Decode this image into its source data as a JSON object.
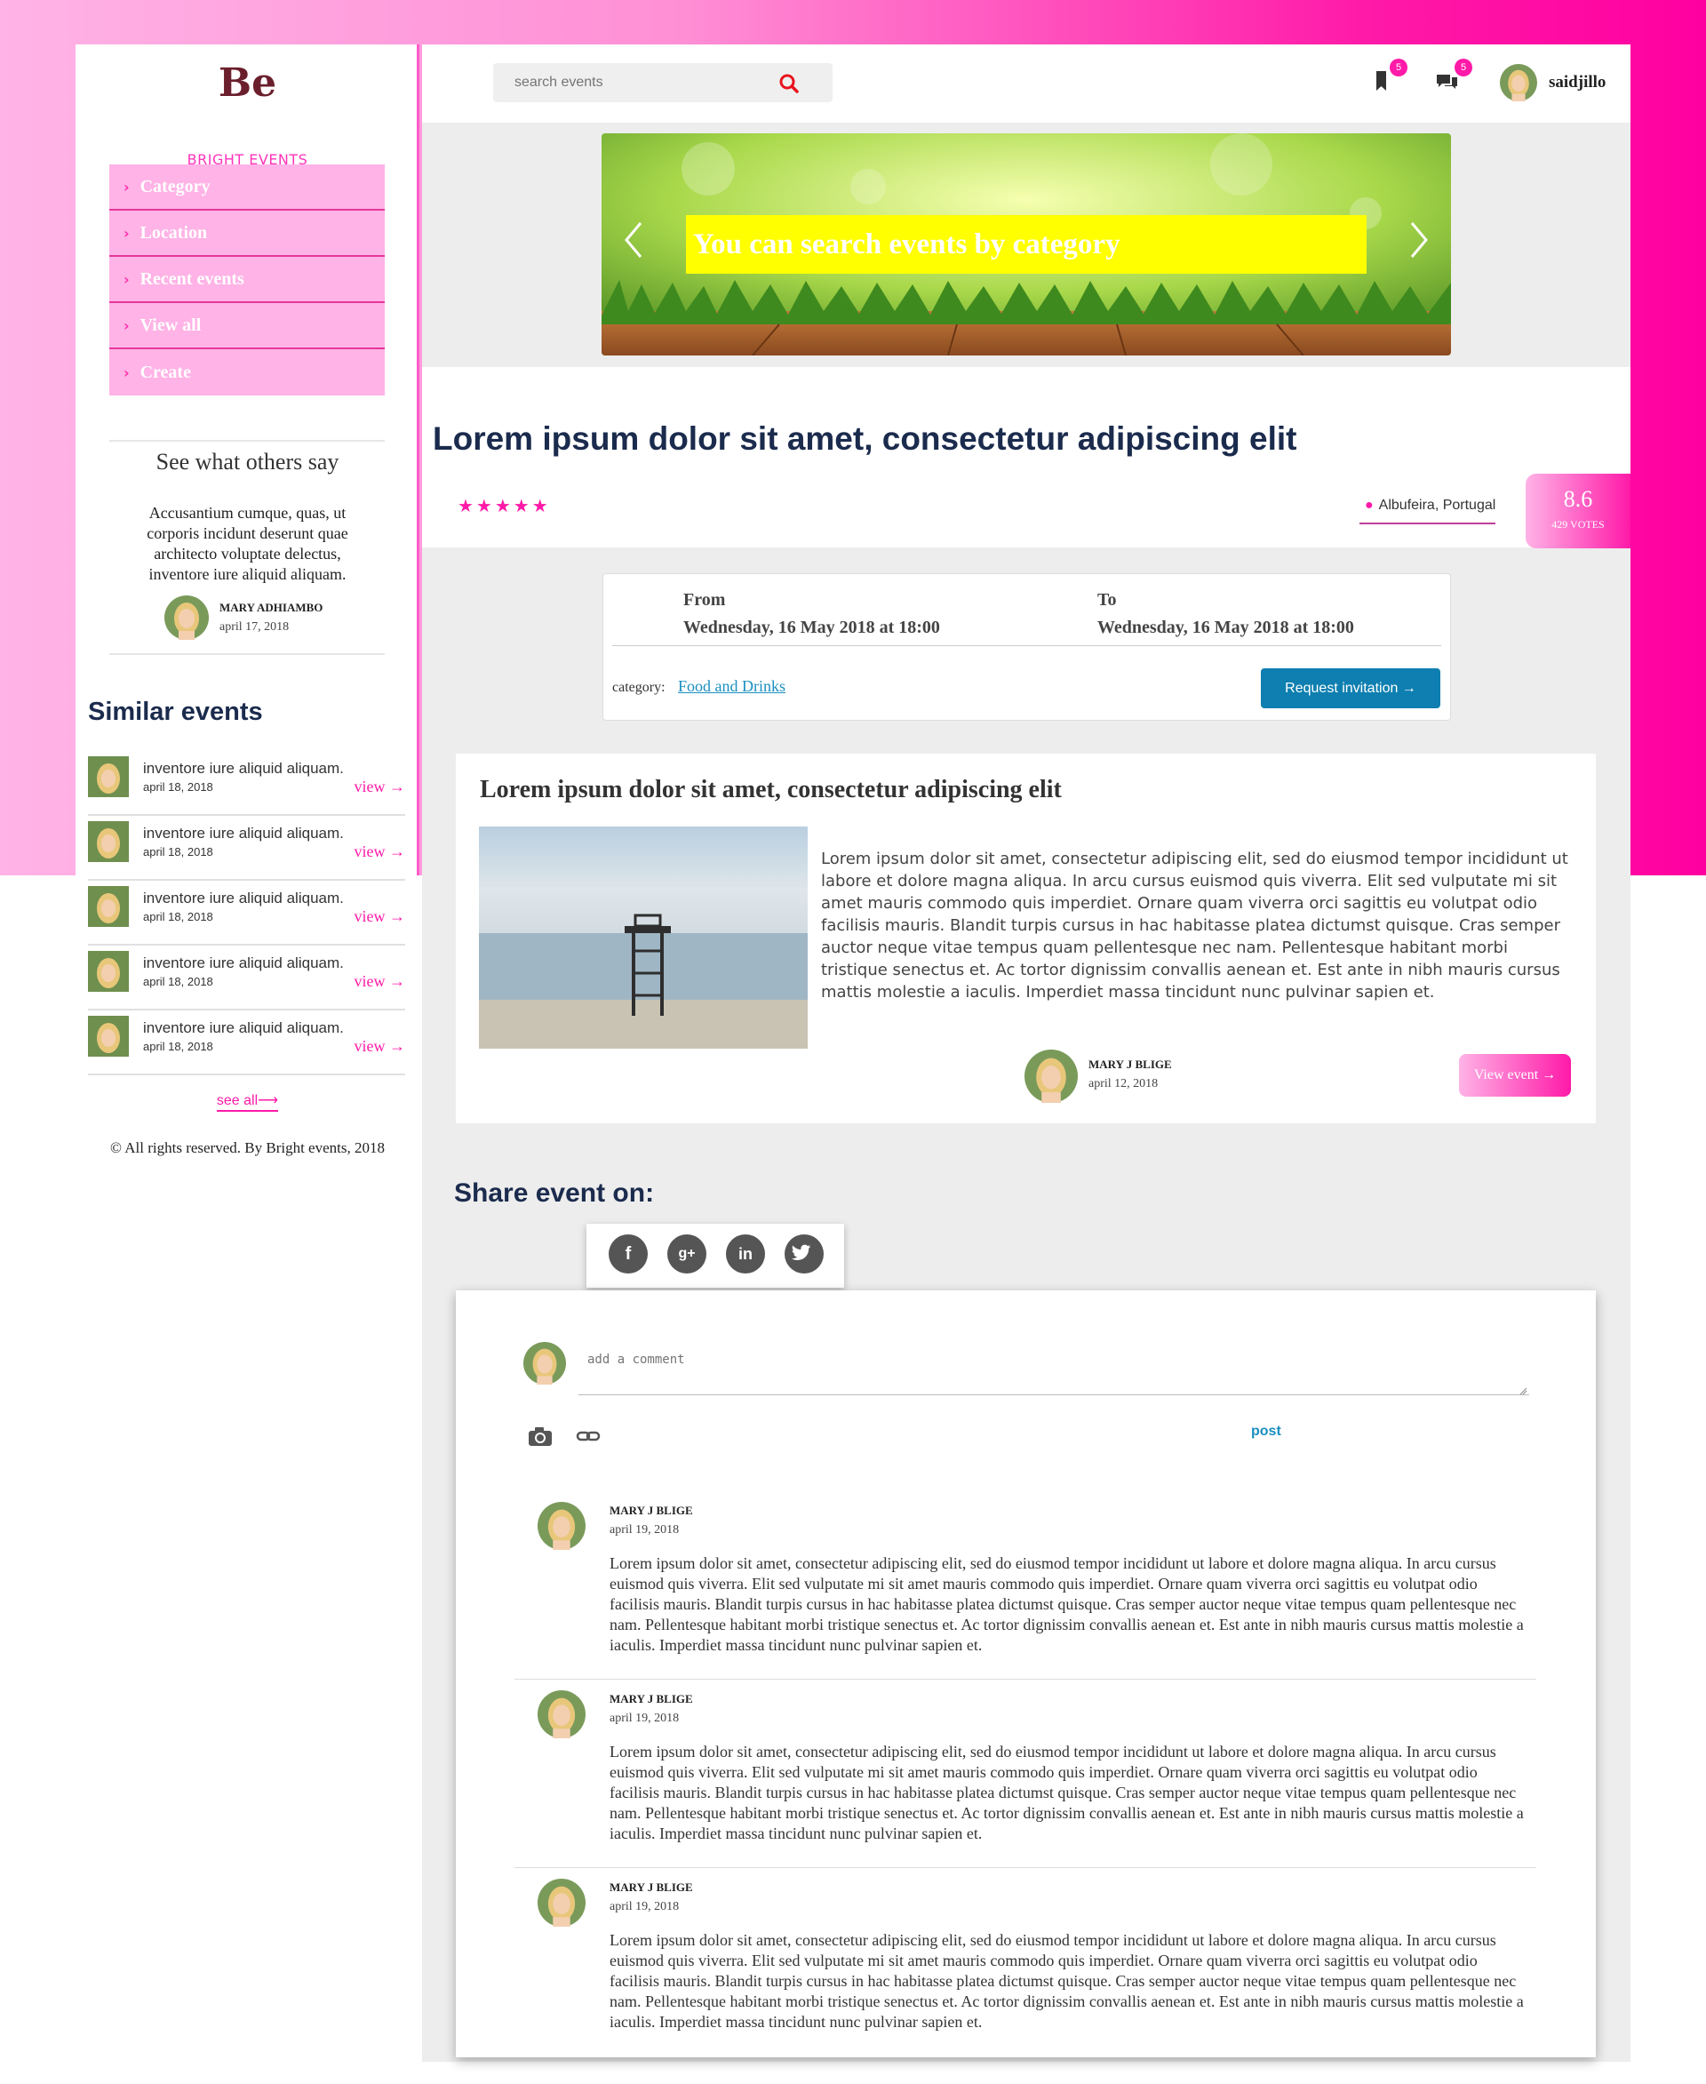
{
  "brand": {
    "logo": "Be",
    "name": "BRIGHT EVENTS"
  },
  "sidebar": {
    "menu": [
      {
        "label": "Category"
      },
      {
        "label": "Location"
      },
      {
        "label": "Recent events"
      },
      {
        "label": "View all"
      },
      {
        "label": "Create"
      }
    ],
    "testimonial": {
      "title": "See what others say",
      "text": "Accusantium cumque, quas, ut corporis incidunt deserunt quae architecto voluptate delectus, inventore iure aliquid aliquam.",
      "author": "MARY ADHIAMBO",
      "date": "april 17, 2018"
    },
    "similar_title": "Similar events",
    "similar": [
      {
        "text": "inventore iure aliquid aliquam.",
        "date": "april 18, 2018",
        "link": "view →"
      },
      {
        "text": "inventore iure aliquid aliquam.",
        "date": "april 18, 2018",
        "link": "view →"
      },
      {
        "text": "inventore iure aliquid aliquam.",
        "date": "april 18, 2018",
        "link": "view →"
      },
      {
        "text": "inventore iure aliquid aliquam.",
        "date": "april 18, 2018",
        "link": "view →"
      },
      {
        "text": "inventore iure aliquid aliquam.",
        "date": "april 18, 2018",
        "link": "view →"
      }
    ],
    "see_all": "see all⟶",
    "copyright": "© All rights reserved. By Bright events, 2018"
  },
  "header": {
    "search_placeholder": "search events",
    "bookmarks_badge": "5",
    "messages_badge": "5",
    "username": "saidjillo"
  },
  "hero": {
    "caption": "You can search events by category"
  },
  "event": {
    "title": "Lorem ipsum dolor sit amet, consectetur adipiscing elit",
    "stars": "★★★★★",
    "rating_value": 5,
    "location": "Albufeira, Portugal",
    "score": "8.6",
    "votes": "429 VOTES",
    "from_label": "From",
    "from_value": "Wednesday, 16 May 2018 at 18:00",
    "to_label": "To",
    "to_value": "Wednesday, 16 May 2018 at 18:00",
    "category_label": "category:",
    "category": "Food and Drinks",
    "request_button": "Request invitation →"
  },
  "description": {
    "title": "Lorem ipsum dolor sit amet, consectetur adipiscing elit",
    "body": "Lorem ipsum dolor sit amet, consectetur adipiscing elit, sed do eiusmod tempor incididunt ut labore et dolore magna aliqua. In arcu cursus euismod quis viverra. Elit sed vulputate mi sit amet mauris commodo quis imperdiet. Ornare quam viverra orci sagittis eu volutpat odio facilisis mauris. Blandit turpis cursus in hac habitasse platea dictumst quisque. Cras semper auctor neque vitae tempus quam pellentesque nec nam. Pellentesque habitant morbi tristique senectus et. Ac tortor dignissim convallis aenean et. Est ante in nibh mauris cursus mattis molestie a iaculis. Imperdiet massa tincidunt nunc pulvinar sapien et.",
    "author": "MARY J BLIGE",
    "date": "april 12, 2018",
    "view_button": "View event →"
  },
  "share": {
    "title": "Share event on:",
    "icons": [
      "facebook-icon",
      "google-plus-icon",
      "linkedin-icon",
      "twitter-icon"
    ]
  },
  "comment_box": {
    "placeholder": "add a comment",
    "post_label": "post"
  },
  "comments": [
    {
      "author": "MARY J BLIGE",
      "date": "april 19, 2018",
      "text": "Lorem ipsum dolor sit amet, consectetur adipiscing elit, sed do eiusmod tempor incididunt ut labore et dolore magna aliqua. In arcu cursus euismod quis viverra. Elit sed vulputate mi sit amet mauris commodo quis imperdiet. Ornare quam viverra orci sagittis eu volutpat odio facilisis mauris. Blandit turpis cursus in hac habitasse platea dictumst quisque. Cras semper auctor neque vitae tempus quam pellentesque nec nam. Pellentesque habitant morbi tristique senectus et. Ac tortor dignissim convallis aenean et. Est ante in nibh mauris cursus mattis molestie a iaculis. Imperdiet massa tincidunt nunc pulvinar sapien et."
    },
    {
      "author": "MARY J BLIGE",
      "date": "april 19, 2018",
      "text": "Lorem ipsum dolor sit amet, consectetur adipiscing elit, sed do eiusmod tempor incididunt ut labore et dolore magna aliqua. In arcu cursus euismod quis viverra. Elit sed vulputate mi sit amet mauris commodo quis imperdiet. Ornare quam viverra orci sagittis eu volutpat odio facilisis mauris. Blandit turpis cursus in hac habitasse platea dictumst quisque. Cras semper auctor neque vitae tempus quam pellentesque nec nam. Pellentesque habitant morbi tristique senectus et. Ac tortor dignissim convallis aenean et. Est ante in nibh mauris cursus mattis molestie a iaculis. Imperdiet massa tincidunt nunc pulvinar sapien et."
    },
    {
      "author": "MARY J BLIGE",
      "date": "april 19, 2018",
      "text": "Lorem ipsum dolor sit amet, consectetur adipiscing elit, sed do eiusmod tempor incididunt ut labore et dolore magna aliqua. In arcu cursus euismod quis viverra. Elit sed vulputate mi sit amet mauris commodo quis imperdiet. Ornare quam viverra orci sagittis eu volutpat odio facilisis mauris. Blandit turpis cursus in hac habitasse platea dictumst quisque. Cras semper auctor neque vitae tempus quam pellentesque nec nam. Pellentesque habitant morbi tristique senectus et. Ac tortor dignissim convallis aenean et. Est ante in nibh mauris cursus mattis molestie a iaculis. Imperdiet massa tincidunt nunc pulvinar sapien et."
    }
  ],
  "colors": {
    "accent": "#ff1aa8",
    "menu_bg": "#ffb3e6",
    "navy": "#1b2b4d",
    "button_blue": "#0e7fb0",
    "hero_caption_bg": "#ffff00"
  }
}
